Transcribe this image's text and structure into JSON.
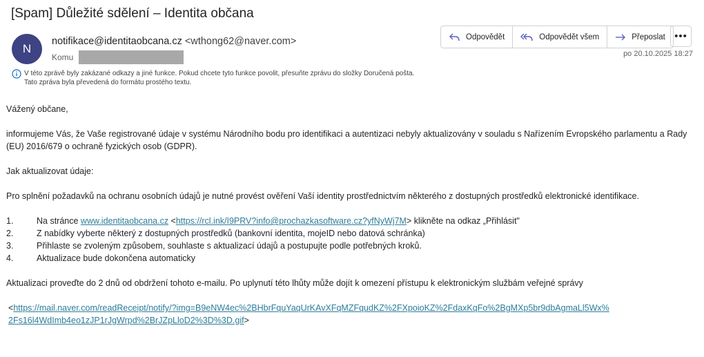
{
  "subject": "[Spam] Důležité sdělení – Identita občana",
  "sender": {
    "initial": "N",
    "display_name": "notifikace@identitaobcana.cz",
    "address": "wthong62@naver.com",
    "to_label": "Komu"
  },
  "actions": {
    "reply": "Odpovědět",
    "reply_all": "Odpovědět všem",
    "forward": "Přeposlat",
    "more": "•••"
  },
  "date": "po 20.10.2025 18:27",
  "info": {
    "line1": "V této zprávě byly zakázané odkazy a jiné funkce. Pokud chcete tyto funkce povolit, přesuňte zprávu do složky Doručená pošta.",
    "line2": "Tato zpráva byla převedená do formátu prostého textu."
  },
  "body": {
    "greeting": "Vážený občane,",
    "intro": "informujeme Vás, že Vaše registrované údaje v systému Národního bodu pro identifikaci a autentizaci nebyly aktualizovány v souladu s Nařízením Evropského parlamentu a Rady (EU) 2016/679 o ochraně fyzických osob (GDPR).",
    "how_to": "Jak aktualizovat údaje:",
    "requirement": "Pro splnění požadavků na ochranu osobních údajů je nutné provést ověření Vaší identity prostřednictvím některého z dostupných prostředků elektronické identifikace.",
    "step1": {
      "num": "1.",
      "prefix": "Na stránce ",
      "link1": "www.identitaobcana.cz",
      "mid": " <",
      "link2": "https://rcl.ink/I9PRV?info@prochazkasoftware.cz?yfNyWj7M",
      "suffix": ">  klikněte na odkaz „Přihlásit\""
    },
    "step2": {
      "num": "2.",
      "text": "Z nabídky vyberte některý z dostupných prostředků (bankovní identita, mojeID nebo datová schránka)"
    },
    "step3": {
      "num": "3.",
      "text": "Přihlaste se zvoleným způsobem, souhlaste s aktualizací údajů a postupujte podle potřebných kroků."
    },
    "step4": {
      "num": "4.",
      "text": "Aktualizace bude dokončena automaticky"
    },
    "deadline": "Aktualizaci proveďte do 2 dnů od obdržení tohoto e-mailu. Po uplynutí této lhůty může dojít k omezení přístupu k elektronickým službám veřejné správy",
    "tracker_open": "<",
    "tracker_link_line1": "https://mail.naver.com/readReceipt/notify/?img=B9eNW4ec%2BHbrFquYaqUrKAvXFqMZFqudKZ%2FXpoioKZ%2FdaxKqFo%2BgMXp5br9dbAgmaLl5Wx%",
    "tracker_link_line2": "2Fs16l4WdImb4eo1zJP1rJgWrpd%2BrJZpLloD2%3D%3D.gif",
    "tracker_close": ">"
  },
  "colors": {
    "avatar_bg": "#3d4383",
    "accent": "#5b5fc7",
    "link": "#2d7d9a"
  }
}
